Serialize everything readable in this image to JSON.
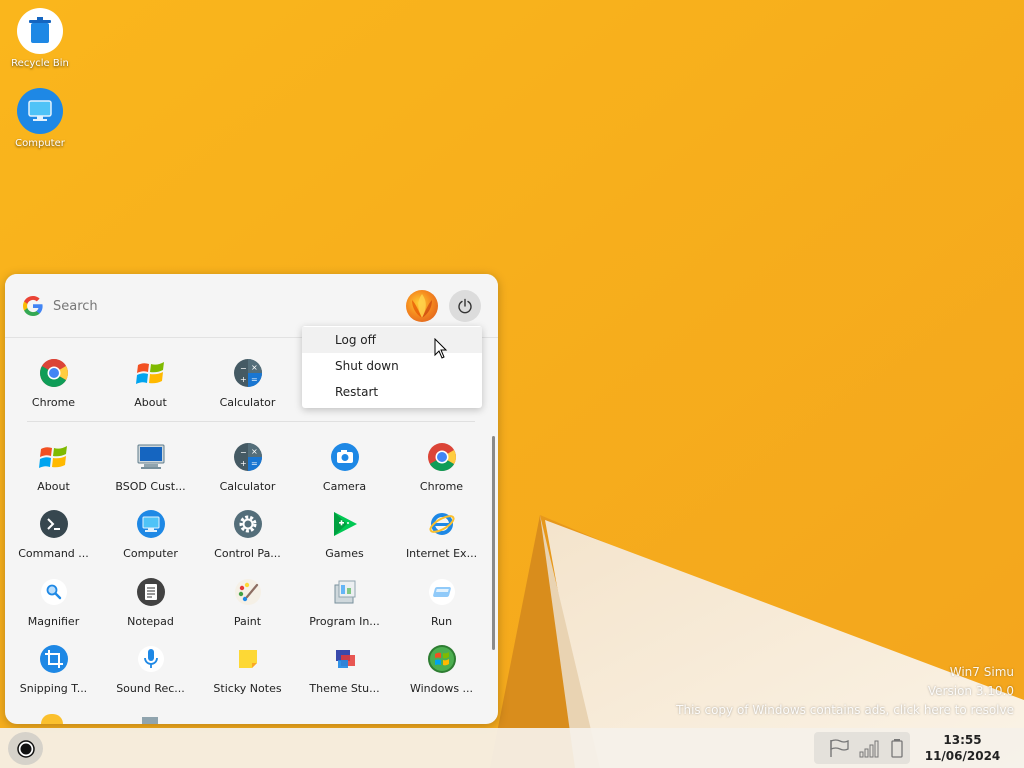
{
  "desktop": {
    "icons": [
      {
        "label": "Recycle Bin"
      },
      {
        "label": "Computer"
      }
    ],
    "watermark": {
      "line1": "Win7 Simu",
      "line2": "Version 3.10.0",
      "line3": "This copy of Windows contains ads, click here to resolve"
    }
  },
  "start_menu": {
    "search": {
      "placeholder": "Search",
      "value": ""
    },
    "pinned": [
      {
        "label": "Chrome",
        "icon": "chrome-icon"
      },
      {
        "label": "About",
        "icon": "windows-flag-icon"
      },
      {
        "label": "Calculator",
        "icon": "calculator-icon"
      }
    ],
    "apps": [
      {
        "label": "About",
        "icon": "windows-flag-icon"
      },
      {
        "label": "BSOD Cust...",
        "icon": "monitor-icon"
      },
      {
        "label": "Calculator",
        "icon": "calculator-icon"
      },
      {
        "label": "Camera",
        "icon": "camera-icon"
      },
      {
        "label": "Chrome",
        "icon": "chrome-icon"
      },
      {
        "label": "Command ...",
        "icon": "terminal-icon"
      },
      {
        "label": "Computer",
        "icon": "computer-icon"
      },
      {
        "label": "Control Pa...",
        "icon": "gear-icon"
      },
      {
        "label": "Games",
        "icon": "games-icon"
      },
      {
        "label": "Internet Ex...",
        "icon": "internet-explorer-icon"
      },
      {
        "label": "Magnifier",
        "icon": "magnifier-icon"
      },
      {
        "label": "Notepad",
        "icon": "notepad-icon"
      },
      {
        "label": "Paint",
        "icon": "paint-palette-icon"
      },
      {
        "label": "Program In...",
        "icon": "installer-icon"
      },
      {
        "label": "Run",
        "icon": "run-icon"
      },
      {
        "label": "Snipping T...",
        "icon": "crop-icon"
      },
      {
        "label": "Sound Rec...",
        "icon": "microphone-icon"
      },
      {
        "label": "Sticky Notes",
        "icon": "sticky-note-icon"
      },
      {
        "label": "Theme Stu...",
        "icon": "theme-icon"
      },
      {
        "label": "Windows ...",
        "icon": "windows-orb-icon"
      }
    ],
    "power_menu": [
      {
        "label": "Log off"
      },
      {
        "label": "Shut down"
      },
      {
        "label": "Restart"
      }
    ]
  },
  "taskbar": {
    "clock": {
      "time": "13:55",
      "date": "11/06/2024"
    },
    "tray_icons": [
      "flag-icon",
      "signal-icon",
      "battery-icon"
    ]
  },
  "colors": {
    "wallpaper": "#f7b21c",
    "menu_bg": "#f5f5f5",
    "taskbar_bg": "#f5f1e9"
  }
}
